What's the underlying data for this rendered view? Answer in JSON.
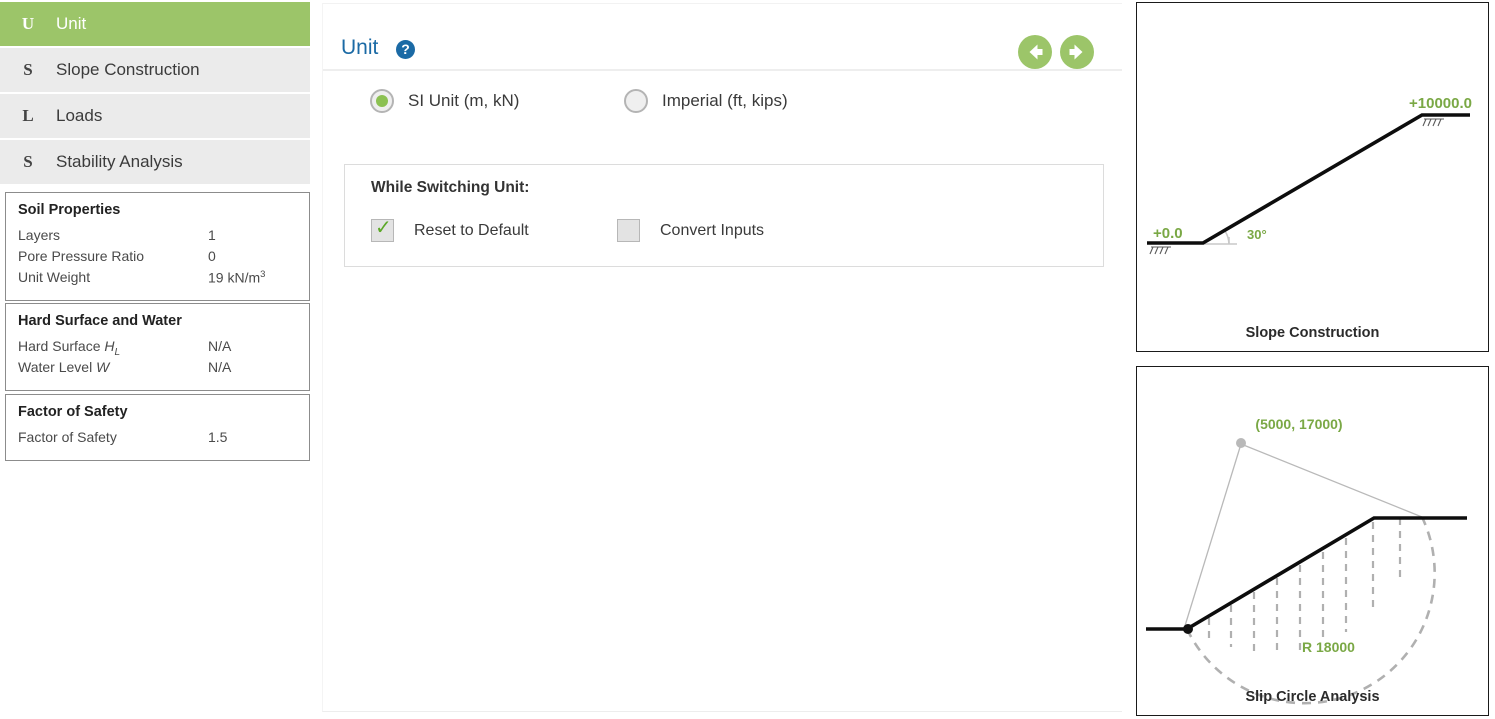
{
  "sidebar": {
    "nav_items": [
      {
        "letter": "U",
        "label": "Unit",
        "active": true
      },
      {
        "letter": "S",
        "label": "Slope Construction",
        "active": false
      },
      {
        "letter": "L",
        "label": "Loads",
        "active": false
      },
      {
        "letter": "S",
        "label": "Stability Analysis",
        "active": false
      }
    ],
    "panels": {
      "soil": {
        "title": "Soil Properties",
        "rows": [
          {
            "label": "Layers",
            "value": "1"
          },
          {
            "label": "Pore Pressure Ratio",
            "value": "0"
          },
          {
            "label": "Unit Weight",
            "value": "19 kN/m3"
          }
        ]
      },
      "water": {
        "title": "Hard Surface and Water",
        "rows": [
          {
            "label": "Hard Surface HL",
            "value": "N/A"
          },
          {
            "label": "Water Level W",
            "value": "N/A"
          }
        ]
      },
      "fos": {
        "title": "Factor of Safety",
        "rows": [
          {
            "label": "Factor of Safety",
            "value": "1.5"
          }
        ]
      }
    }
  },
  "main": {
    "title": "Unit",
    "help_icon": "question-mark-icon",
    "prev_icon": "arrow-left-circle-icon",
    "next_icon": "arrow-right-circle-icon",
    "unit_options": [
      {
        "label": "SI Unit (m, kN)",
        "selected": true
      },
      {
        "label": "Imperial (ft, kips)",
        "selected": false
      }
    ],
    "switch_section": {
      "title": "While Switching Unit:",
      "checkboxes": [
        {
          "label": "Reset to Default",
          "checked": true,
          "mark": "✓"
        },
        {
          "label": "Convert Inputs",
          "checked": false,
          "mark": "✓"
        }
      ]
    }
  },
  "diagrams": {
    "slope": {
      "caption": "Slope Construction",
      "base_elevation": "+0.0",
      "crest_elevation": "+10000.0",
      "angle": "30°"
    },
    "slip": {
      "caption": "Slip Circle Analysis",
      "center_label": "(5000, 17000)",
      "radius_label": "R 18000"
    }
  },
  "colors": {
    "accent_green": "#9cc569",
    "title_blue": "#1b6aa5",
    "label_green": "#7aa845",
    "row_gray": "#ebebeb"
  }
}
